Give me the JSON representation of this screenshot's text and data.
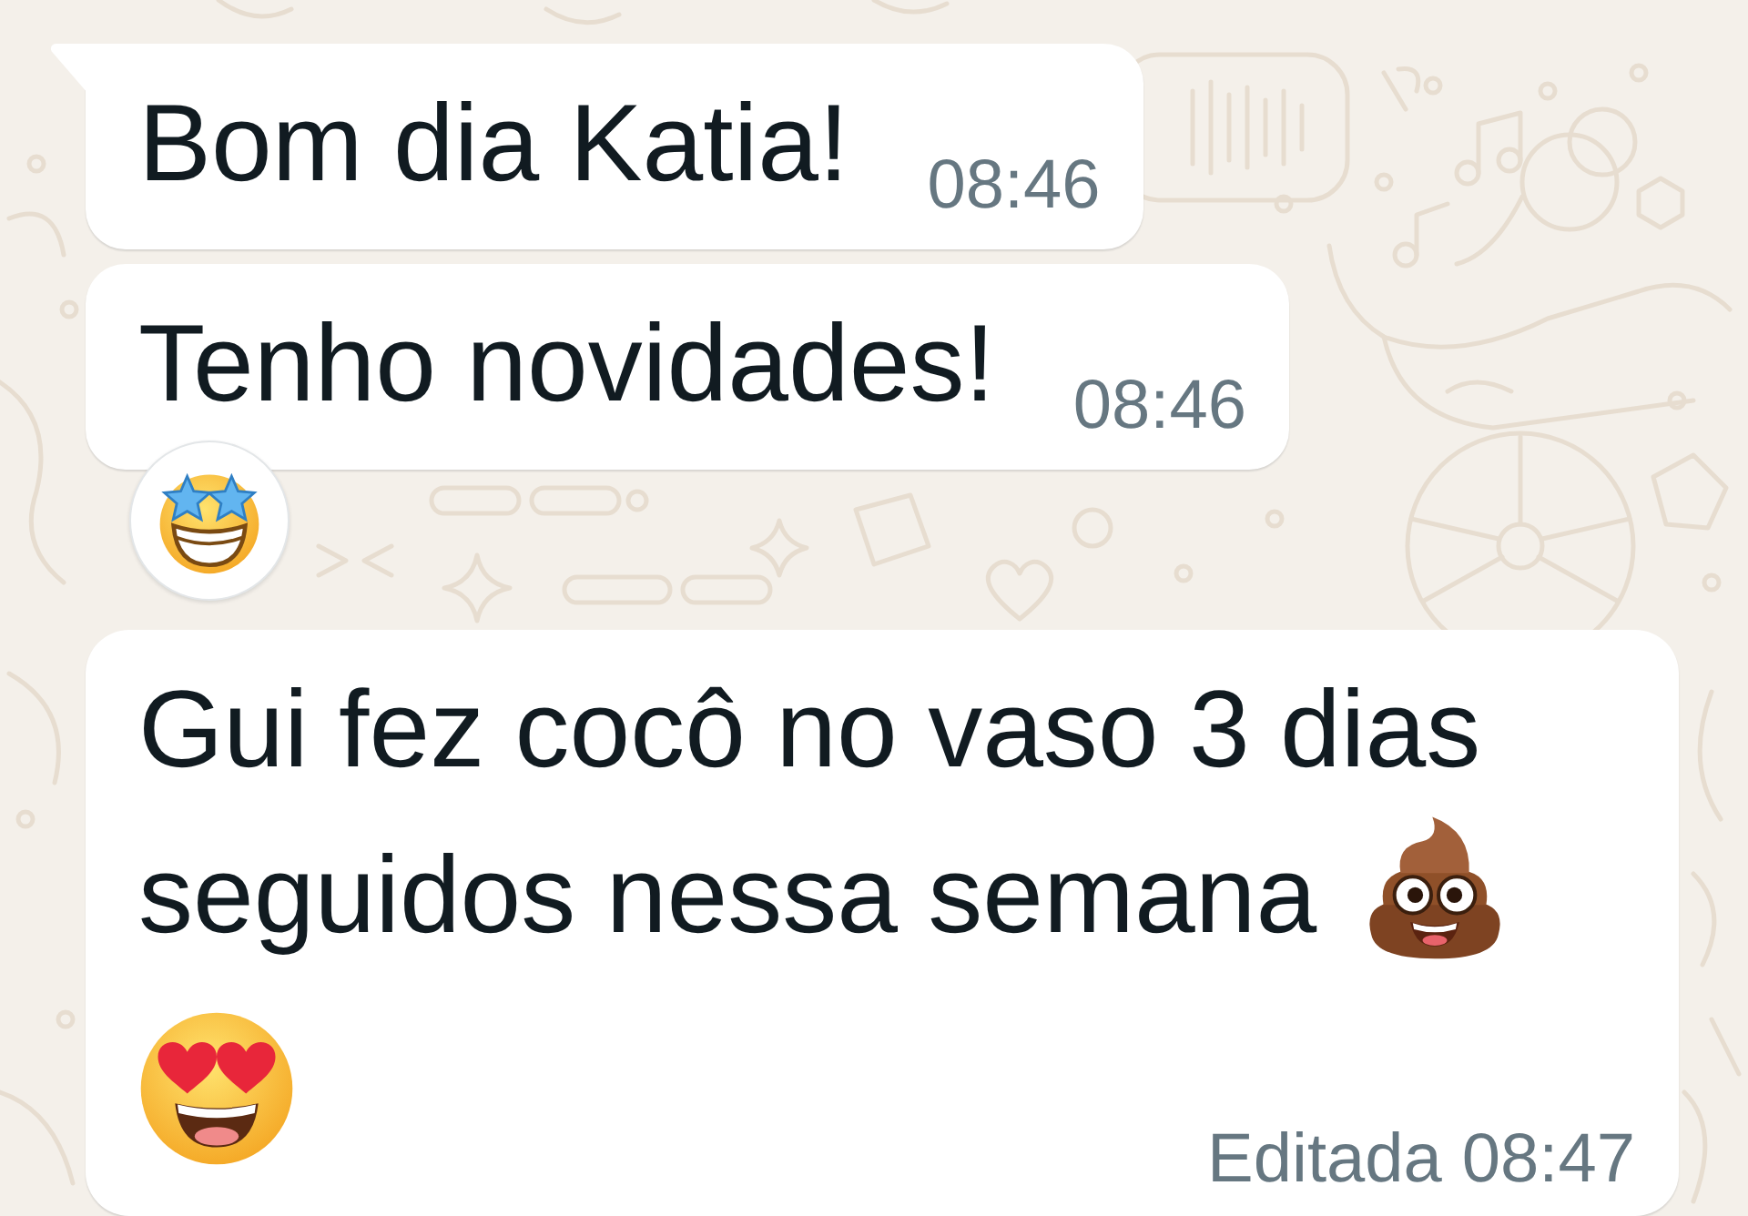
{
  "messages": [
    {
      "kind": "text",
      "lines": [
        "Bom dia Katia!"
      ],
      "time": "08:46",
      "tail": true,
      "reacted": false
    },
    {
      "kind": "text",
      "lines": [
        "Tenho novidades!"
      ],
      "time": "08:46",
      "tail": false,
      "reacted": true
    },
    {
      "kind": "emoji_text",
      "lines": [
        "Gui fez cocô no vaso 3 dias",
        "seguidos nessa semana"
      ],
      "edited_label": "Editada",
      "time": "08:47",
      "tail": false,
      "reacted": false
    }
  ]
}
